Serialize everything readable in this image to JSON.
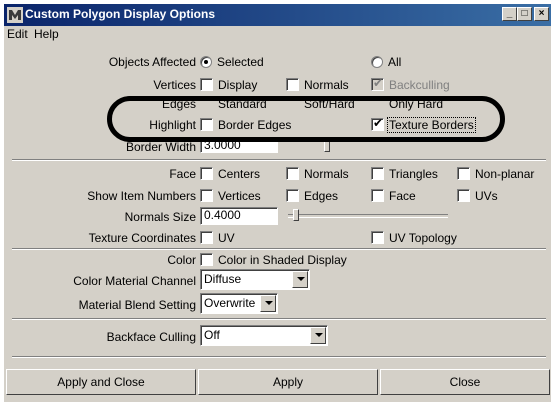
{
  "window": {
    "title": "Custom Polygon Display Options"
  },
  "menu": {
    "edit": "Edit",
    "help": "Help"
  },
  "objects_affected": {
    "label": "Objects Affected",
    "selected": "Selected",
    "all": "All"
  },
  "vertices": {
    "label": "Vertices",
    "display": "Display",
    "normals": "Normals",
    "backculling": "Backculling"
  },
  "edges": {
    "label": "Edges",
    "standard": "Standard",
    "soft_hard": "Soft/Hard",
    "only_hard": "Only Hard"
  },
  "highlight": {
    "label": "Highlight",
    "border_edges": "Border Edges",
    "texture_borders": "Texture Borders"
  },
  "border_width": {
    "label": "Border Width",
    "value": "3.0000"
  },
  "face": {
    "label": "Face",
    "centers": "Centers",
    "normals": "Normals",
    "triangles": "Triangles",
    "non_planar": "Non-planar"
  },
  "show_item_numbers": {
    "label": "Show Item Numbers",
    "vertices": "Vertices",
    "edges": "Edges",
    "face": "Face",
    "uvs": "UVs"
  },
  "normals_size": {
    "label": "Normals Size",
    "value": "0.4000"
  },
  "texture_coordinates": {
    "label": "Texture Coordinates",
    "uv": "UV",
    "uv_topology": "UV Topology"
  },
  "color": {
    "label": "Color",
    "option": "Color in Shaded Display"
  },
  "color_material_channel": {
    "label": "Color Material Channel",
    "value": "Diffuse"
  },
  "material_blend_setting": {
    "label": "Material Blend Setting",
    "value": "Overwrite"
  },
  "backface_culling": {
    "label": "Backface Culling",
    "value": "Off"
  },
  "buttons": {
    "apply_close": "Apply and Close",
    "apply": "Apply",
    "close": "Close"
  }
}
